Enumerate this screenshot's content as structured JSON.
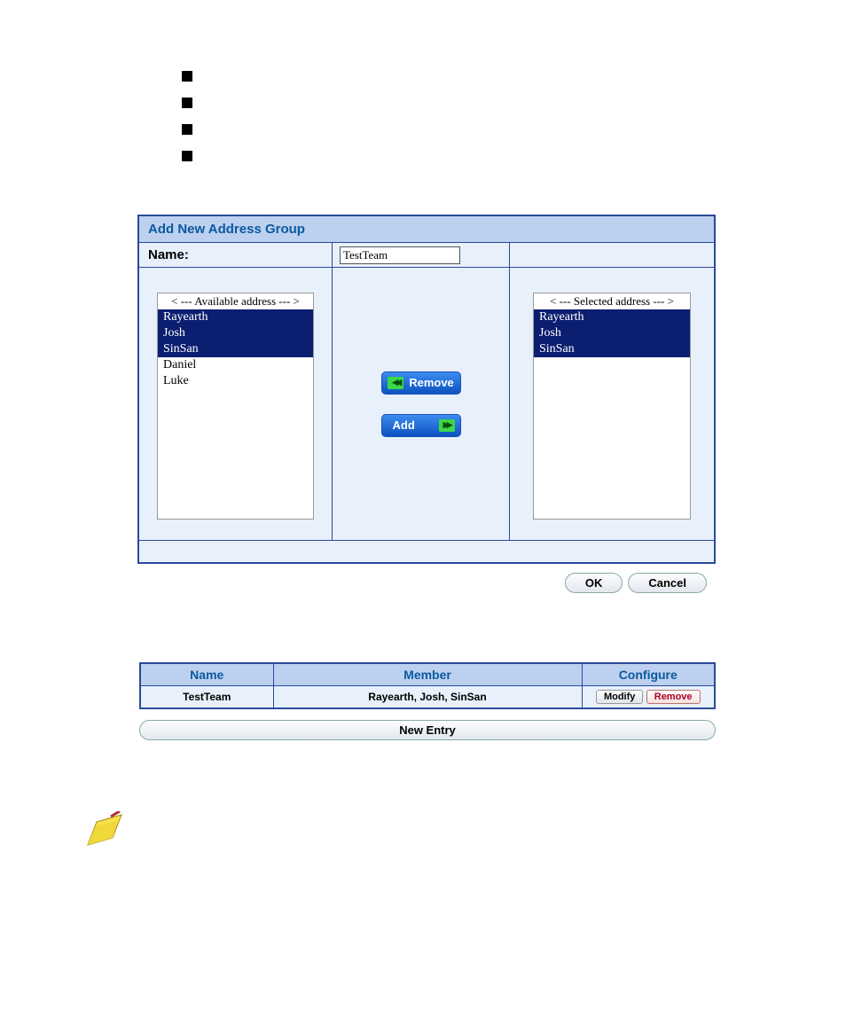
{
  "dialog": {
    "title": "Add New Address Group",
    "name_label": "Name:",
    "name_value": "TestTeam"
  },
  "available": {
    "label": "< --- Available address --- >",
    "items": [
      {
        "text": "Rayearth",
        "selected": true
      },
      {
        "text": "Josh",
        "selected": true
      },
      {
        "text": "SinSan",
        "selected": true
      },
      {
        "text": "Daniel",
        "selected": false
      },
      {
        "text": "Luke",
        "selected": false
      }
    ]
  },
  "selected": {
    "label": "< --- Selected address --- >",
    "items": [
      {
        "text": "Rayearth",
        "selected": true
      },
      {
        "text": "Josh",
        "selected": true
      },
      {
        "text": "SinSan",
        "selected": true
      }
    ]
  },
  "buttons": {
    "remove": "Remove",
    "add": "Add",
    "ok": "OK",
    "cancel": "Cancel",
    "new_entry": "New Entry",
    "modify": "Modify",
    "remove_small": "Remove"
  },
  "table": {
    "headers": {
      "name": "Name",
      "member": "Member",
      "configure": "Configure"
    },
    "rows": [
      {
        "name": "TestTeam",
        "member": "Rayearth, Josh, SinSan"
      }
    ]
  }
}
